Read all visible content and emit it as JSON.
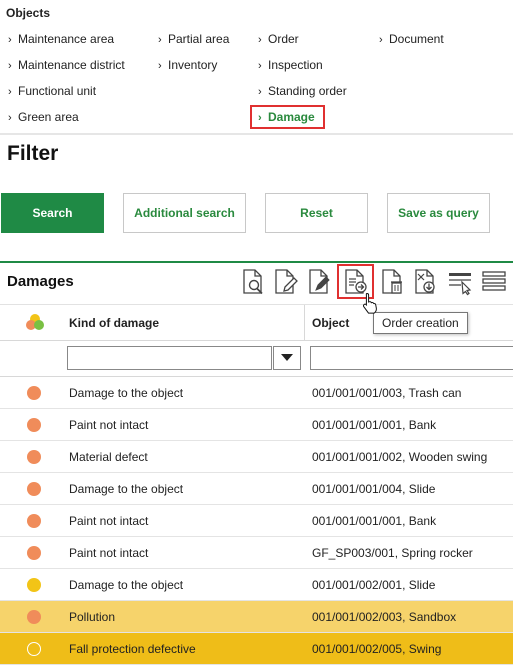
{
  "objects": {
    "title": "Objects",
    "items": [
      {
        "label": "Maintenance area"
      },
      {
        "label": "Partial area"
      },
      {
        "label": "Order"
      },
      {
        "label": "Document"
      },
      {
        "label": "Maintenance district"
      },
      {
        "label": "Inventory"
      },
      {
        "label": "Inspection"
      },
      {
        "label": "Functional unit"
      },
      {
        "label": "Standing order"
      },
      {
        "label": "Green area"
      },
      {
        "label": "Damage",
        "active": true
      }
    ],
    "chevron": "›",
    "accent_color": "#2a8a3e",
    "highlight_color": "#e03030"
  },
  "filter": {
    "title": "Filter",
    "buttons": {
      "search": "Search",
      "additional_search": "Additional search",
      "reset": "Reset",
      "save_as_query": "Save as query"
    }
  },
  "damages": {
    "title": "Damages",
    "toolbar_icons": [
      "document-search-icon",
      "document-edit-icon",
      "document-pen-icon",
      "order-creation-icon",
      "document-delete-icon",
      "document-download-icon",
      "column-filter-icon",
      "menu-lines-icon"
    ],
    "tooltip": "Order creation",
    "columns": {
      "status": "",
      "kind": "Kind of damage",
      "object": "Object"
    },
    "filters": {
      "kind_value": "",
      "object_value": ""
    },
    "status_colors": {
      "orange": "#f08c5a",
      "yellow": "#f2c417"
    },
    "rows": [
      {
        "status": "orange",
        "kind": "Damage to the object",
        "object": "001/001/001/003, Trash can",
        "highlight": "none"
      },
      {
        "status": "orange",
        "kind": "Paint not intact",
        "object": "001/001/001/001, Bank",
        "highlight": "none"
      },
      {
        "status": "orange",
        "kind": "Material defect",
        "object": "001/001/001/002, Wooden swing",
        "highlight": "none"
      },
      {
        "status": "orange",
        "kind": "Damage to the object",
        "object": "001/001/001/004, Slide",
        "highlight": "none"
      },
      {
        "status": "orange",
        "kind": "Paint not intact",
        "object": "001/001/001/001, Bank",
        "highlight": "none"
      },
      {
        "status": "orange",
        "kind": "Paint not intact",
        "object": "GF_SP003/001, Spring rocker",
        "highlight": "none"
      },
      {
        "status": "yellow",
        "kind": "Damage to the object",
        "object": "001/001/002/001, Slide",
        "highlight": "none"
      },
      {
        "status": "orange",
        "kind": "Pollution",
        "object": "001/001/002/003, Sandbox",
        "highlight": "light"
      },
      {
        "status": "yellow",
        "kind": "Fall protection defective",
        "object": "001/001/002/005, Swing",
        "highlight": "strong"
      }
    ]
  }
}
